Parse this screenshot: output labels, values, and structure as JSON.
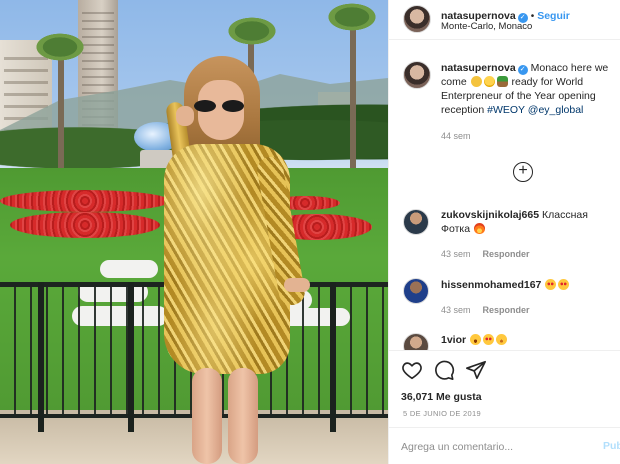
{
  "post": {
    "author": "natasupernova",
    "follow_label": "Seguir",
    "location": "Monte-Carlo, Monaco"
  },
  "caption": {
    "username": "natasupernova",
    "text_before": " Monaco here we come ",
    "text_after": " ready for World Enterpreneur of the Year opening reception ",
    "hashtag": "#WEOY",
    "mention": "@ey_global",
    "age": "44 sem"
  },
  "load_more_label": "+",
  "comments": [
    {
      "username": "zukovskijnikolaj665",
      "text": " Классная Фотка ",
      "age": "43 sem",
      "reply": "Responder"
    },
    {
      "username": "hissenmohamed167",
      "text": " ",
      "age": "43 sem",
      "reply": "Responder"
    },
    {
      "username": "1vior",
      "text": " "
    }
  ],
  "stats": {
    "likes": "36,071 Me gusta",
    "date": "5 DE JUNIO DE 2019"
  },
  "comment_box": {
    "placeholder": "Agrega un comentario...",
    "publish_label": "Pub"
  },
  "colors": {
    "accent": "#3897f0",
    "link": "#00376b",
    "muted": "#8e8e8e",
    "publish_disabled": "#b2dffc"
  }
}
